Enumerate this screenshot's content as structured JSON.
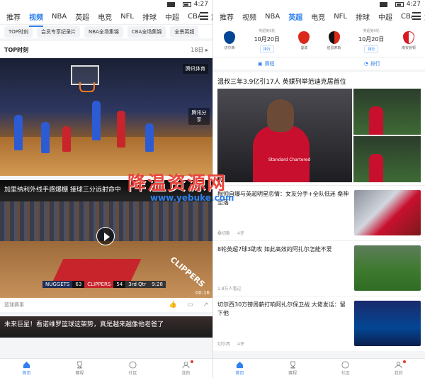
{
  "left": {
    "status_time": "4:27",
    "tabs": [
      "推荐",
      "视频",
      "NBA",
      "英超",
      "电竞",
      "NFL",
      "排球",
      "中超",
      "CBA",
      "意!"
    ],
    "active_tab_index": 1,
    "subtabs": [
      "TOP时刻",
      "会员专享纪录片",
      "NBA全场集锦",
      "CBA全场集锦",
      "全景英超"
    ],
    "section": {
      "title": "TOP时刻",
      "count": "18日 ▸"
    },
    "video1": {
      "logo": "腾讯体育",
      "share": "腾讯分享"
    },
    "video2": {
      "title": "加里纳利外线手感爆棚 接球三分远射命中",
      "score": {
        "team1": "NUGGETS",
        "score1": "63",
        "team2": "CLIPPERS",
        "score2": "54",
        "quarter": "3rd Qtr",
        "clock": "9:28"
      },
      "duration": "00:16",
      "source": "篮球赛事",
      "court_text": "CLIPPERS"
    },
    "video3": {
      "title": "未来巨星！看诺维罗篮球这架势，真是越来越像他老爸了"
    },
    "nav": [
      "首页",
      "赛程",
      "社区",
      "我的"
    ],
    "active_nav_index": 0
  },
  "right": {
    "status_time": "4:27",
    "tabs": [
      "推荐",
      "视频",
      "NBA",
      "英超",
      "电竞",
      "NFL",
      "排球",
      "中超",
      "CBA",
      "意!"
    ],
    "active_tab_index": 3,
    "matches": [
      {
        "home": "切尔西",
        "away": "曼联",
        "league": "英超第9轮",
        "date": "10月20日",
        "btn": "排行"
      },
      {
        "home": "伯恩茅斯",
        "away": "南安普顿",
        "league": "英超第9轮",
        "date": "10月20日",
        "btn": "排行"
      }
    ],
    "quick": [
      "赛程",
      "排行"
    ],
    "headline": {
      "title": "温叔三年3.9亿引17人 英媒列举范迪克居首位",
      "sponsor": "Standard Chartered"
    },
    "news": [
      {
        "title": "穆帅自爆与英超明星恋情：女友分手+全队低迷 桑神坠落",
        "meta1": "桑切斯",
        "meta2": "4评"
      },
      {
        "title": "8轮英超7球3助攻 如此高效的阿扎尔怎能不爱",
        "meta1": "1.8万人看过",
        "meta2": ""
      },
      {
        "title": "切尔西30万镑周薪打响阿扎尔保卫战  大佬发话：留下他",
        "meta1": "切尔西",
        "meta2": "4评"
      }
    ],
    "nav": [
      "首页",
      "赛程",
      "社区",
      "我的"
    ],
    "active_nav_index": 0
  },
  "watermark": {
    "cn": "降温资源网",
    "url": "www.yebuke.com"
  },
  "colors": {
    "accent": "#2f80ed",
    "red": "#c8242b",
    "bg": "#f4f5f7"
  }
}
